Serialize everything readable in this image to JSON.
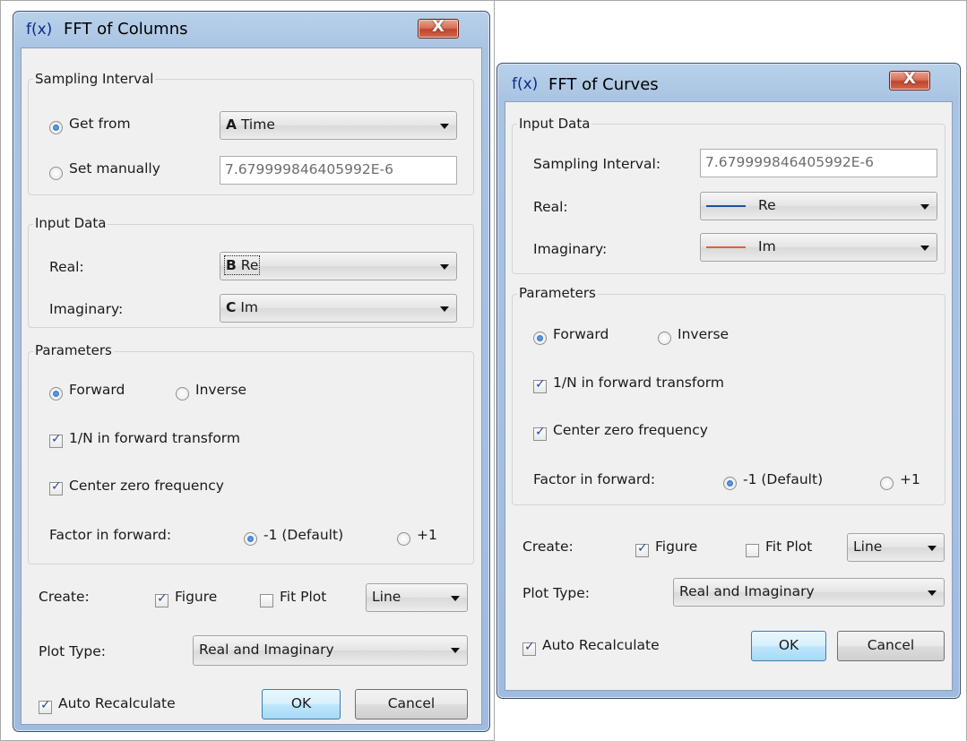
{
  "left_dialog": {
    "fx": "f(x)",
    "title": "FFT of Columns",
    "close_symbol": "X",
    "sampling": {
      "group_title": "Sampling Interval",
      "get_from_label": "Get from",
      "get_from_col": "A",
      "get_from_name": "Time",
      "set_manually_label": "Set manually",
      "manual_value": "7.679999846405992E-6"
    },
    "input": {
      "group_title": "Input Data",
      "real_label": "Real:",
      "real_col": "B",
      "real_name": "Re",
      "imag_label": "Imaginary:",
      "imag_col": "C",
      "imag_name": "Im"
    },
    "params": {
      "group_title": "Parameters",
      "forward": "Forward",
      "inverse": "Inverse",
      "one_over_n": "1/N in forward transform",
      "center_zero": "Center zero frequency",
      "factor_label": "Factor in forward:",
      "factor_default": "-1 (Default)",
      "factor_plus": "+1"
    },
    "create_label": "Create:",
    "figure": "Figure",
    "fit_plot": "Fit Plot",
    "line": "Line",
    "plot_type_label": "Plot Type:",
    "plot_type_value": "Real and Imaginary",
    "auto_recalc": "Auto Recalculate",
    "ok": "OK",
    "cancel": "Cancel"
  },
  "right_dialog": {
    "fx": "f(x)",
    "title": "FFT of Curves",
    "close_symbol": "X",
    "input": {
      "group_title": "Input Data",
      "sampling_label": "Sampling Interval:",
      "sampling_value": "7.679999846405992E-6",
      "real_label": "Real:",
      "real_name": "Re",
      "imag_label": "Imaginary:",
      "imag_name": "Im"
    },
    "params": {
      "group_title": "Parameters",
      "forward": "Forward",
      "inverse": "Inverse",
      "one_over_n": "1/N in forward transform",
      "center_zero": "Center zero frequency",
      "factor_label": "Factor in forward:",
      "factor_default": "-1 (Default)",
      "factor_plus": "+1"
    },
    "create_label": "Create:",
    "figure": "Figure",
    "fit_plot": "Fit Plot",
    "line": "Line",
    "plot_type_label": "Plot Type:",
    "plot_type_value": "Real and Imaginary",
    "auto_recalc": "Auto Recalculate",
    "ok": "OK",
    "cancel": "Cancel"
  },
  "colors": {
    "real_line": "#1f4fa0",
    "imag_line": "#ef5a32",
    "close_button": "#c9553e"
  }
}
